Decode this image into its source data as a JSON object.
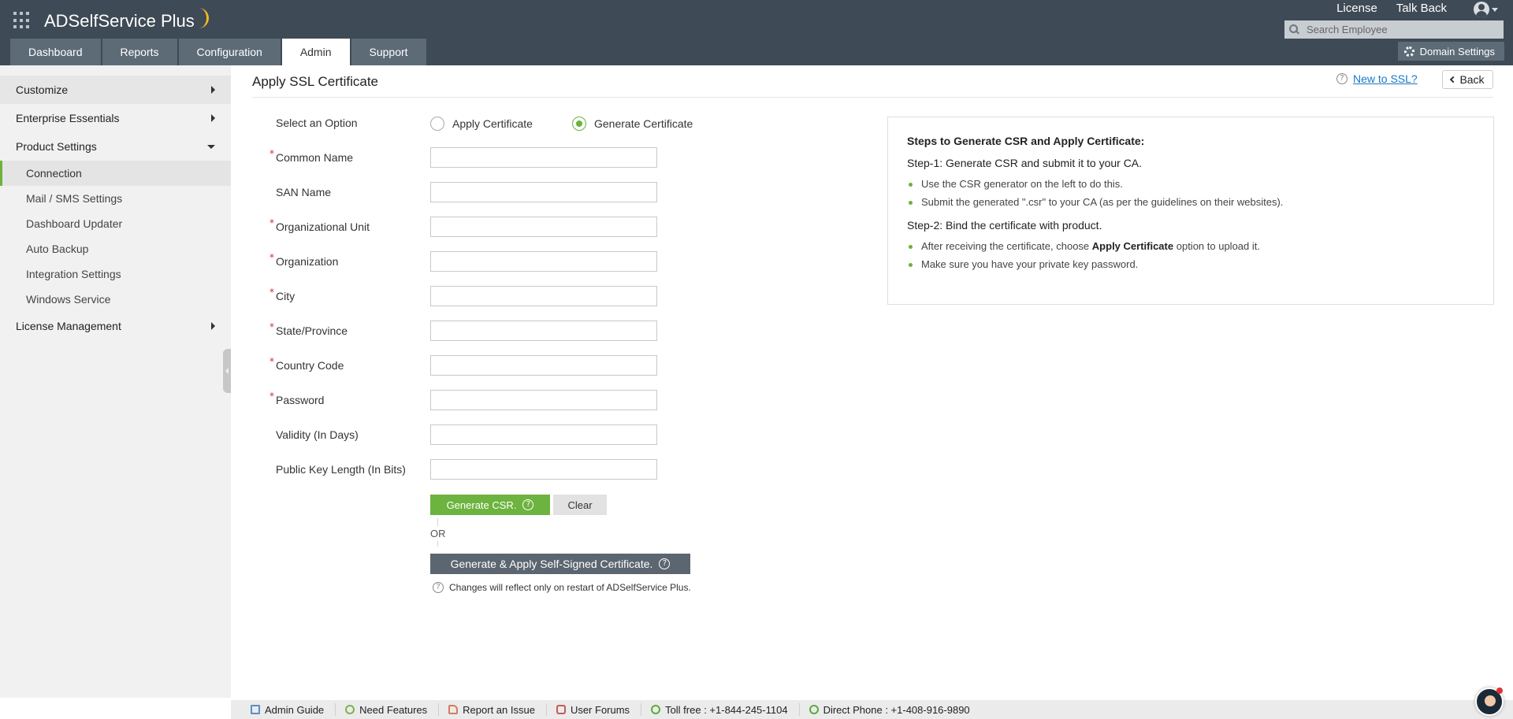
{
  "header": {
    "app_name": "ADSelfService Plus",
    "top_links": [
      "License",
      "Talk Back"
    ],
    "search_placeholder": "Search Employee",
    "tabs": [
      {
        "label": "Dashboard",
        "active": false
      },
      {
        "label": "Reports",
        "active": false
      },
      {
        "label": "Configuration",
        "active": false
      },
      {
        "label": "Admin",
        "active": true
      },
      {
        "label": "Support",
        "active": false
      }
    ],
    "domain_settings": "Domain Settings"
  },
  "sidebar": {
    "sections": [
      {
        "label": "Customize",
        "expanded": false
      },
      {
        "label": "Enterprise Essentials",
        "expanded": false
      },
      {
        "label": "Product Settings",
        "expanded": true
      },
      {
        "label": "License Management",
        "expanded": false
      }
    ],
    "product_settings_items": [
      {
        "label": "Connection",
        "active": true
      },
      {
        "label": "Mail / SMS Settings",
        "active": false
      },
      {
        "label": "Dashboard Updater",
        "active": false
      },
      {
        "label": "Auto Backup",
        "active": false
      },
      {
        "label": "Integration Settings",
        "active": false
      },
      {
        "label": "Windows Service",
        "active": false
      }
    ]
  },
  "main": {
    "title": "Apply SSL Certificate",
    "help_link": "New to SSL?",
    "back": "Back",
    "option_label": "Select an Option",
    "options": [
      {
        "label": "Apply Certificate",
        "selected": false
      },
      {
        "label": "Generate Certificate",
        "selected": true
      }
    ],
    "fields": [
      {
        "label": "Common Name",
        "required": true,
        "value": ""
      },
      {
        "label": "SAN Name",
        "required": false,
        "value": ""
      },
      {
        "label": "Organizational Unit",
        "required": true,
        "value": ""
      },
      {
        "label": "Organization",
        "required": true,
        "value": ""
      },
      {
        "label": "City",
        "required": true,
        "value": ""
      },
      {
        "label": "State/Province",
        "required": true,
        "value": ""
      },
      {
        "label": "Country Code",
        "required": true,
        "value": ""
      },
      {
        "label": "Password",
        "required": true,
        "value": ""
      },
      {
        "label": "Validity (In Days)",
        "required": false,
        "value": ""
      },
      {
        "label": "Public Key Length (In Bits)",
        "required": false,
        "value": ""
      }
    ],
    "generate_csr": "Generate CSR.",
    "clear": "Clear",
    "or": "OR",
    "self_signed": "Generate & Apply Self-Signed Certificate.",
    "note": "Changes will reflect only on restart of ADSelfService Plus."
  },
  "steps": {
    "heading": "Steps to Generate CSR and Apply Certificate:",
    "step1": "Step-1: Generate CSR and submit it to your CA.",
    "step1_items": [
      "Use the CSR generator on the left to do this.",
      "Submit the generated \".csr\" to your CA (as per the guidelines on their websites)."
    ],
    "step2": "Step-2: Bind the certificate with product.",
    "step2_item1_pre": "After receiving the certificate, choose",
    "step2_item1_bold": "Apply Certificate",
    "step2_item1_post": "option to upload it.",
    "step2_item2": "Make sure you have your private key password."
  },
  "footer": {
    "items": [
      {
        "label": "Admin Guide",
        "icon": "book-icon"
      },
      {
        "label": "Need Features",
        "icon": "bulb-icon"
      },
      {
        "label": "Report an Issue",
        "icon": "flag-icon"
      },
      {
        "label": "User Forums",
        "icon": "forum-icon"
      },
      {
        "label": "Toll free : +1-844-245-1104",
        "icon": "phone-icon"
      },
      {
        "label": "Direct Phone : +1-408-916-9890",
        "icon": "phone-icon"
      }
    ]
  },
  "colors": {
    "header_bg": "#3e4a55",
    "accent_green": "#6db33f",
    "link_blue": "#1b78c6",
    "required_red": "#d62c2c"
  }
}
